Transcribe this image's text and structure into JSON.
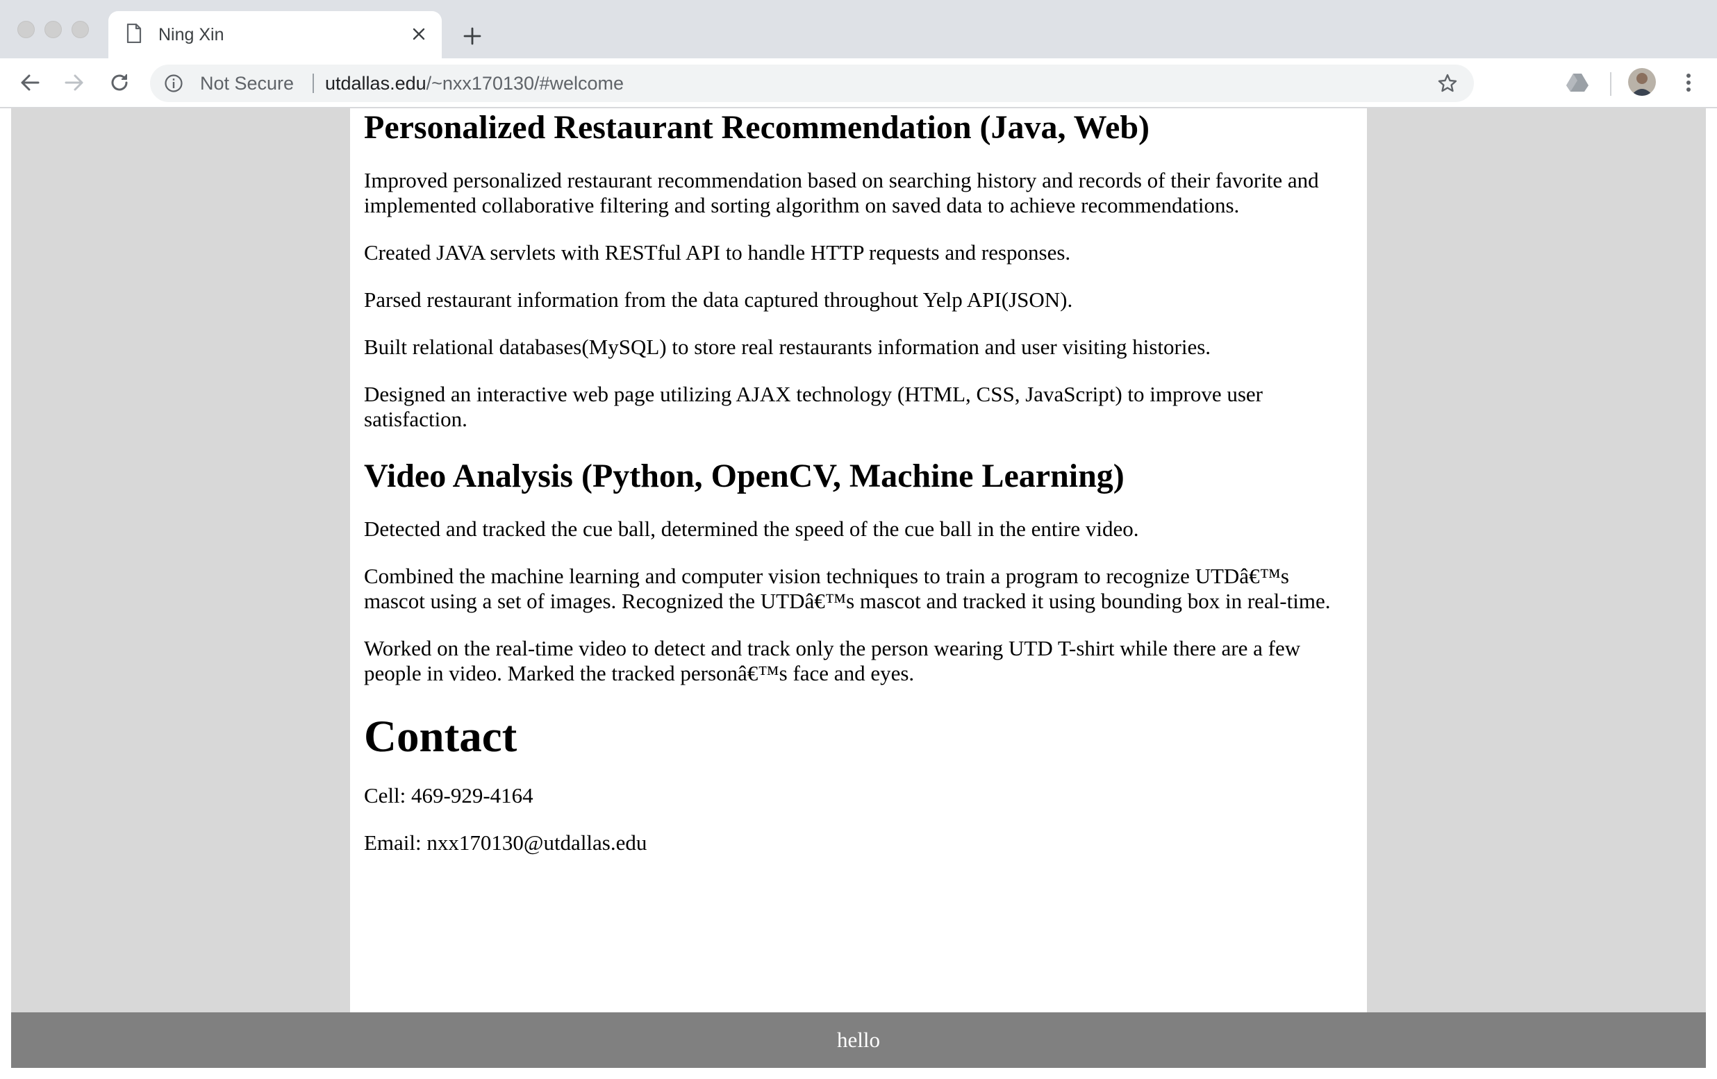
{
  "browser": {
    "tab_title": "Ning Xin",
    "security_label": "Not Secure",
    "url_host": "utdallas.edu",
    "url_path": "/~nxx170130/#welcome"
  },
  "projects": [
    {
      "title": "Personalized Restaurant Recommendation (Java, Web)",
      "bullets": [
        "Improved personalized restaurant recommendation based on searching history and records of their favorite and implemented collaborative filtering and sorting algorithm on saved data to achieve recommendations.",
        "Created JAVA servlets with RESTful API to handle HTTP requests and responses.",
        "Parsed restaurant information from the data captured throughout Yelp API(JSON).",
        "Built relational databases(MySQL) to store real restaurants information and user visiting histories.",
        "Designed an interactive web page utilizing AJAX technology (HTML, CSS, JavaScript) to improve user satisfaction."
      ]
    },
    {
      "title": "Video Analysis (Python, OpenCV, Machine Learning)",
      "bullets": [
        "Detected and tracked the cue ball, determined the speed of the cue ball in the entire video.",
        "Combined the machine learning and computer vision techniques to train a program to recognize UTDâ€™s mascot using a set of images. Recognized the UTDâ€™s mascot and tracked it using bounding box in real-time.",
        "Worked on the real-time video to detect and track only the person wearing UTD T-shirt while there are a few people in video. Marked the tracked personâ€™s face and eyes."
      ]
    }
  ],
  "contact": {
    "heading": "Contact",
    "cell": "Cell: 469-929-4164",
    "email": "Email: nxx170130@utdallas.edu"
  },
  "footer": {
    "text": "hello"
  }
}
